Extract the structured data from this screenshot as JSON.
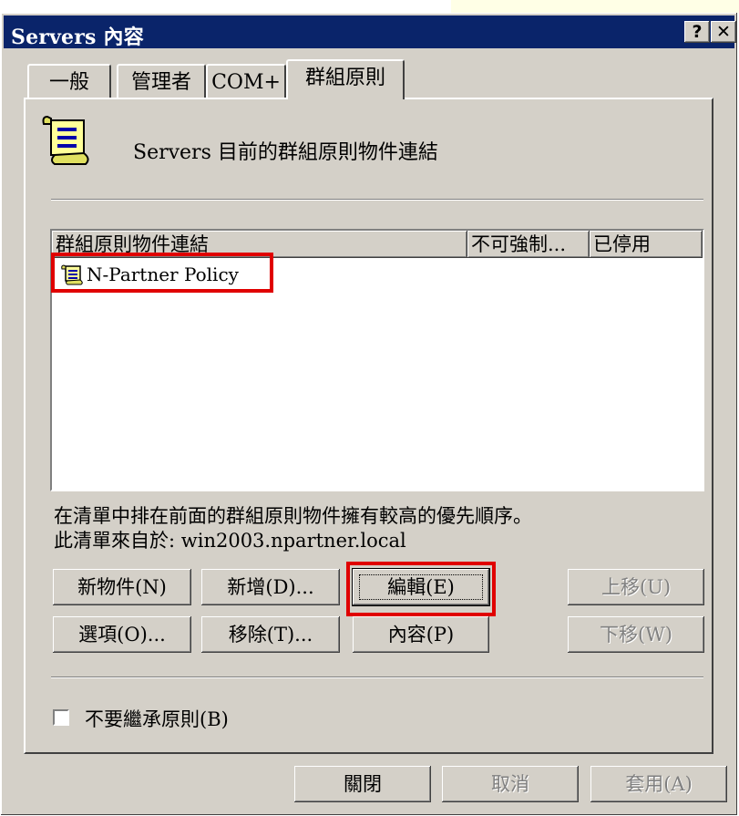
{
  "window": {
    "title": "Servers 內容"
  },
  "title_buttons": {
    "help": "?",
    "close": "✕"
  },
  "tabs": [
    {
      "label": "一般"
    },
    {
      "label": "管理者"
    },
    {
      "label": "COM+"
    },
    {
      "label": "群組原則",
      "active": true
    }
  ],
  "header": {
    "text": "Servers 目前的群組原則物件連結",
    "icon": "policy-scroll-icon"
  },
  "list": {
    "columns": [
      "群組原則物件連結",
      "不可強制...",
      "已停用"
    ],
    "rows": [
      {
        "name": "N-Partner Policy",
        "icon": "policy-scroll-icon"
      }
    ]
  },
  "info": {
    "priority_note": "在清單中排在前面的群組原則物件擁有較高的優先順序。",
    "source": "此清單來自於: win2003.npartner.local"
  },
  "buttons": {
    "new_object": "新物件(N)",
    "add": "新增(D)...",
    "edit": "編輯(E)",
    "move_up": "上移(U)",
    "options": "選項(O)...",
    "delete": "移除(T)...",
    "properties": "內容(P)",
    "move_down": "下移(W)"
  },
  "checkbox": {
    "label": "不要繼承原則(B)",
    "checked": false
  },
  "footer": {
    "close": "關閉",
    "cancel": "取消",
    "apply": "套用(A)"
  },
  "colors": {
    "titlebar": "#0a246a",
    "face": "#d4d0c8",
    "highlight": "#e00000"
  }
}
